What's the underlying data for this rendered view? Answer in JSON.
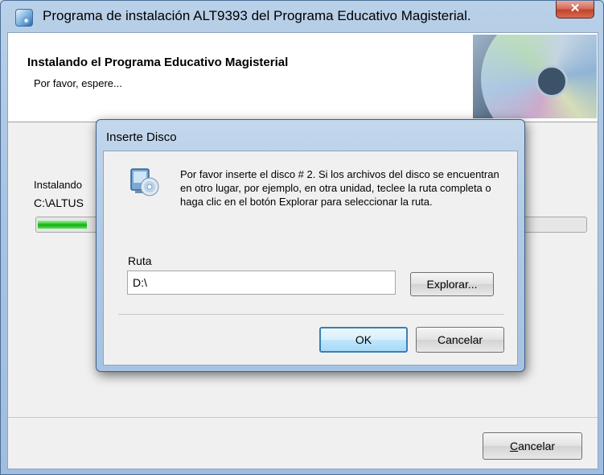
{
  "window": {
    "title": "Programa de instalación ALT9393 del Programa Educativo Magisterial.",
    "close_glyph": "✕",
    "icon": "installer-icon"
  },
  "header": {
    "title": "Instalando el Programa Educativo Magisterial",
    "subtitle": "Por favor, espere..."
  },
  "body": {
    "status_label": "Instalando",
    "path_text": "C:\\ALTUS",
    "progress_fraction": 0.09
  },
  "footer": {
    "cancel_prefix": "",
    "cancel_underlined": "C",
    "cancel_rest": "ancelar"
  },
  "dialog": {
    "title": "Inserte Disco",
    "icon": "disk-drive-icon",
    "message": "Por favor inserte el disco # 2.  Si los archivos del disco se encuentran en otro lugar, por ejemplo, en otra unidad, teclee la ruta completa o haga clic en el botón Explorar para seleccionar la ruta.",
    "ruta_label": "Ruta",
    "ruta_value": "D:\\",
    "explorar_label": "Explorar...",
    "ok_label": "OK",
    "cancel_label": "Cancelar"
  },
  "colors": {
    "progress_green": "#22c322",
    "default_button_border": "#3c7fb1"
  }
}
